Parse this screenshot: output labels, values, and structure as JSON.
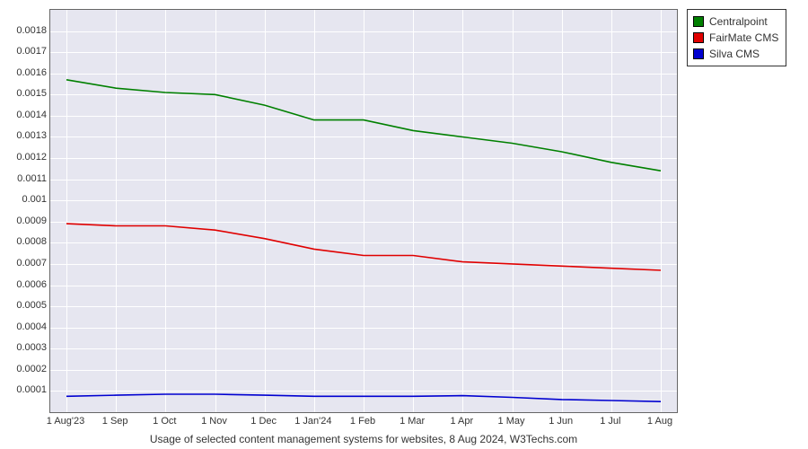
{
  "caption": "Usage of selected content management systems for websites, 8 Aug 2024, W3Techs.com",
  "legend": {
    "items": [
      {
        "label": "Centralpoint",
        "color": "#008000"
      },
      {
        "label": "FairMate CMS",
        "color": "#e00000"
      },
      {
        "label": "Silva CMS",
        "color": "#0000d0"
      }
    ]
  },
  "chart_data": {
    "type": "line",
    "xlabel": "",
    "ylabel": "",
    "categories": [
      "1 Aug'23",
      "1 Sep",
      "1 Oct",
      "1 Nov",
      "1 Dec",
      "1 Jan'24",
      "1 Feb",
      "1 Mar",
      "1 Apr",
      "1 May",
      "1 Jun",
      "1 Jul",
      "1 Aug"
    ],
    "ylim": [
      0,
      0.0019
    ],
    "y_ticks": [
      0.0001,
      0.0002,
      0.0003,
      0.0004,
      0.0005,
      0.0006,
      0.0007,
      0.0008,
      0.0009,
      0.001,
      0.0011,
      0.0012,
      0.0013,
      0.0014,
      0.0015,
      0.0016,
      0.0017,
      0.0018
    ],
    "series": [
      {
        "name": "Centralpoint",
        "color": "#008000",
        "values": [
          0.00157,
          0.00153,
          0.00151,
          0.0015,
          0.00145,
          0.00138,
          0.00138,
          0.00133,
          0.0013,
          0.00127,
          0.00123,
          0.00118,
          0.00114
        ]
      },
      {
        "name": "FairMate CMS",
        "color": "#e00000",
        "values": [
          0.00089,
          0.00088,
          0.00088,
          0.00086,
          0.00082,
          0.00077,
          0.00074,
          0.00074,
          0.00071,
          0.0007,
          0.00069,
          0.00068,
          0.00067
        ]
      },
      {
        "name": "Silva CMS",
        "color": "#0000d0",
        "values": [
          7.5e-05,
          8e-05,
          8.5e-05,
          8.5e-05,
          8e-05,
          7.5e-05,
          7.5e-05,
          7.5e-05,
          7.8e-05,
          7e-05,
          6e-05,
          5.5e-05,
          5e-05
        ]
      }
    ]
  }
}
